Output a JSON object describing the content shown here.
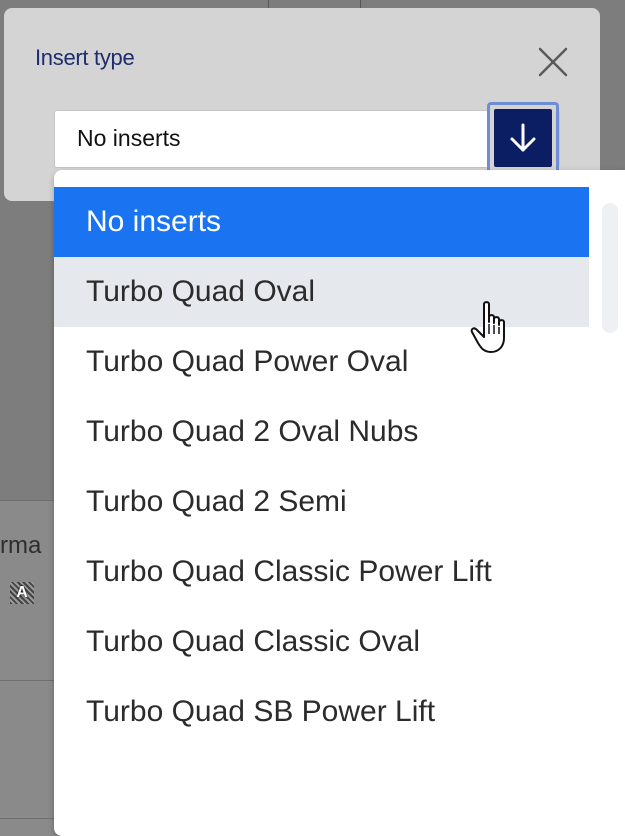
{
  "dialog": {
    "title": "Insert type",
    "close_icon": "close-icon"
  },
  "select": {
    "value": "No inserts",
    "toggle_icon": "arrow-down-icon",
    "expanded": true
  },
  "dropdown": {
    "options": [
      {
        "label": "No inserts",
        "state": "selected"
      },
      {
        "label": "Turbo Quad Oval",
        "state": "hovered"
      },
      {
        "label": "Turbo Quad Power Oval",
        "state": "normal"
      },
      {
        "label": "Turbo Quad 2 Oval Nubs",
        "state": "normal"
      },
      {
        "label": "Turbo Quad 2 Semi",
        "state": "normal"
      },
      {
        "label": "Turbo Quad Classic Power Lift",
        "state": "normal"
      },
      {
        "label": "Turbo Quad Classic Oval",
        "state": "normal"
      },
      {
        "label": "Turbo Quad SB Power Lift",
        "state": "normal"
      }
    ]
  },
  "background": {
    "partial_label": "rma",
    "badge_letter": "A"
  },
  "colors": {
    "selected_bg": "#1a73f0",
    "hover_bg": "#e5e8ed",
    "title_color": "#1f2c6e",
    "button_navy": "#0b1d63",
    "overlay": "#7d7d7d"
  },
  "cursor_icon": "hand-pointer-icon"
}
